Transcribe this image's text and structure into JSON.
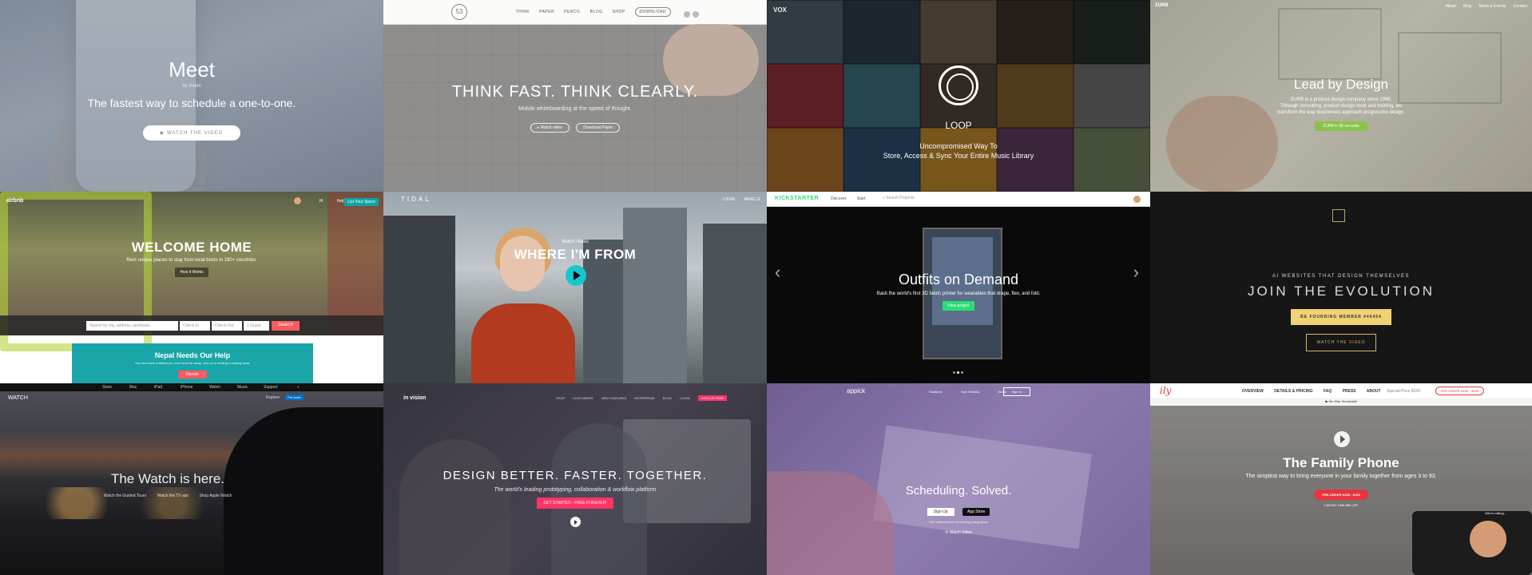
{
  "meet": {
    "title": "Meet",
    "byline": "by Xobni",
    "tagline": "The fastest way to schedule a one-to-one.",
    "cta": "WATCH THE VIDEO"
  },
  "paper": {
    "logo": "53",
    "nav": [
      "THINK",
      "PAPER",
      "PENCIL",
      "BLOG",
      "SHOP"
    ],
    "download": "DOWNLOAD",
    "headline": "THINK FAST. THINK CLEARLY.",
    "sub": "Mobile whiteboarding at the speed of thought.",
    "btn_video": "Watch video",
    "btn_download": "Download Paper"
  },
  "loop": {
    "brand": "VOX",
    "title": "LOOP",
    "line1": "Uncompromised Way To",
    "line2": "Store, Access & Sync Your Entire Music Library",
    "album_colors": [
      "#4b5b66",
      "#2f3b45",
      "#6a5a4a",
      "#3a2f2a",
      "#26302a",
      "#8a2f36",
      "#3a6a7a",
      "#4a4038",
      "#7a5a2a",
      "#6a6a6a",
      "#a86a2a",
      "#2a4a6a",
      "#b8842a",
      "#5a3a5a",
      "#6a7a5a"
    ]
  },
  "zurb": {
    "brand": "ZURB",
    "nav": [
      "About",
      "Blog",
      "News & Events",
      "Contact"
    ],
    "headline": "Lead by Design",
    "p1": "ZURB is a product design company since 1998.",
    "p2": "Through consulting, product design tools and training, we",
    "p3": "transform the way businesses approach progressive design.",
    "cta": "ZURB in 90 seconds"
  },
  "airbnb": {
    "logo": "airbnb",
    "user": "Hi",
    "help": "Help",
    "list": "List Your Space",
    "headline": "WELCOME HOME",
    "sub": "Rent unique places to stay from local hosts in 190+ countries.",
    "btn": "How it Works",
    "search_where": "Search by city, address, landmark...",
    "check_in": "Check In",
    "check_out": "Check Out",
    "guests": "1 Guest",
    "search": "Search",
    "banner_title": "Nepal Needs Our Help",
    "banner_text": "You can make a difference, even from far away. Join us in lending a helping hand.",
    "donate": "Donate"
  },
  "tidal": {
    "logo": "TIDAL",
    "nav": [
      "LOGIN",
      "MENU"
    ],
    "watch": "Watch Video",
    "headline": "WHERE I'M FROM"
  },
  "kick": {
    "logo": "KICKSTARTER",
    "nav": [
      "Discover",
      "Start"
    ],
    "search": "Search Projects",
    "headline": "Outfits on Demand",
    "sub": "Back the world's first 3D fabric printer for wearables that drape, flex, and fold.",
    "cta": "View project",
    "prev": "‹",
    "next": "›"
  },
  "grid": {
    "kicker": "AI WEBSITES THAT DESIGN THEMSELVES",
    "headline": "JOIN THE EVOLUTION",
    "founding": "BE FOUNDING MEMBER #46454",
    "video": "WATCH THE VIDEO"
  },
  "watch": {
    "nav": [
      "Store",
      "Mac",
      "iPad",
      "iPhone",
      "Watch",
      "Music",
      "Support"
    ],
    "brand": "WATCH",
    "overview": "Explore",
    "buy": "Pre-order",
    "headline": "The Watch is here.",
    "links": [
      "Watch the Guided Tours",
      "Watch the TV ads",
      "Shop Apple Watch"
    ]
  },
  "invision": {
    "logo": "in vision",
    "nav": [
      "TOUR",
      "CUSTOMERS",
      "NEW FEATURES",
      "ENTERPRISE",
      "BLOG",
      "LOGIN"
    ],
    "signup": "SIGN UP FREE",
    "headline": "DESIGN BETTER. FASTER. TOGETHER.",
    "sub": "The world's leading prototyping, collaboration & workflow platform",
    "cta": "GET STARTED - FREE FOREVER!"
  },
  "appick": {
    "logo": "appick",
    "nav": [
      "Solutions",
      "How It Works",
      "About"
    ],
    "signup": "Sign In",
    "headline": "Scheduling. Solved.",
    "w": "Sign Up",
    "store": "App Store",
    "fine": "Get notified about Scheduling integrations",
    "video": "Watch Video"
  },
  "ily": {
    "logo": "ily",
    "nav": [
      "OVERVIEW",
      "DETAILS & PRICING",
      "FAQ",
      "PRESS",
      "ABOUT"
    ],
    "price": "Special Price $199",
    "preorder": "PRE-ORDER NOW - $199",
    "ship": "We Ship Worldwide!",
    "headline": "The Family Phone",
    "sub": "The simplest way to bring everyone in your family together from ages 3 to 93.",
    "cta": "PRE-ORDER NOW - $199",
    "limited": "LIMITED TIME $50 OFF",
    "bubble": "Who's calling..."
  }
}
